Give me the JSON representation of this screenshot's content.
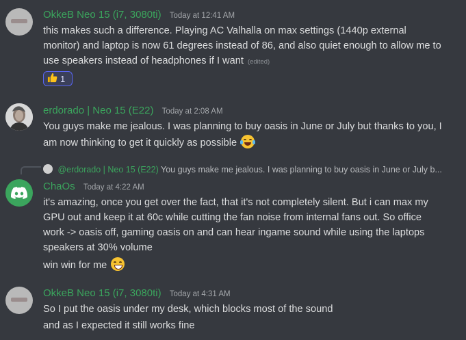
{
  "colors": {
    "green_name": "#3ba55d",
    "background": "#36393f",
    "reaction_border": "#5865f2"
  },
  "messages": [
    {
      "author": "OkkeB Neo 15 (i7, 3080ti)",
      "time": "Today at 12:41 AM",
      "lines": [
        "this makes such a difference. Playing AC Valhalla on max settings (1440p external",
        "monitor) and laptop is now 61 degrees instead of 86, and also quiet enough to allow me to",
        "use speakers instead of headphones if I want"
      ],
      "edited": "(edited)",
      "reaction": {
        "icon": "thumbs-up-icon",
        "count": "1"
      }
    },
    {
      "author": "erdorado | Neo 15 (E22)",
      "time": "Today at 2:08 AM",
      "lines": [
        "You guys make me jealous. I was planning to buy oasis in June or July but thanks to you, I",
        "am now thinking to get it quickly as possible"
      ]
    },
    {
      "reply": {
        "author": "@erdorado | Neo 15 (E22)",
        "text": "You guys make me jealous. I was planning to buy oasis in June or July b..."
      },
      "author": "ChaOs",
      "time": "Today at 4:22 AM",
      "lines": [
        "it's amazing, once you get over the fact, that it's not completely silent. But i can max my",
        "GPU out and keep it at 60c while cutting the fan noise from internal fans out. So office",
        "work -> oasis off, gaming oasis on and can hear ingame sound while using the laptops",
        "speakers at 30% volume"
      ],
      "line2": "win win for me"
    },
    {
      "author": "OkkeB Neo 15 (i7, 3080ti)",
      "time": "Today at 4:31 AM",
      "lines": [
        "So I put the oasis under my desk, which blocks most of the sound",
        "and as I expected it still works fine"
      ]
    }
  ]
}
